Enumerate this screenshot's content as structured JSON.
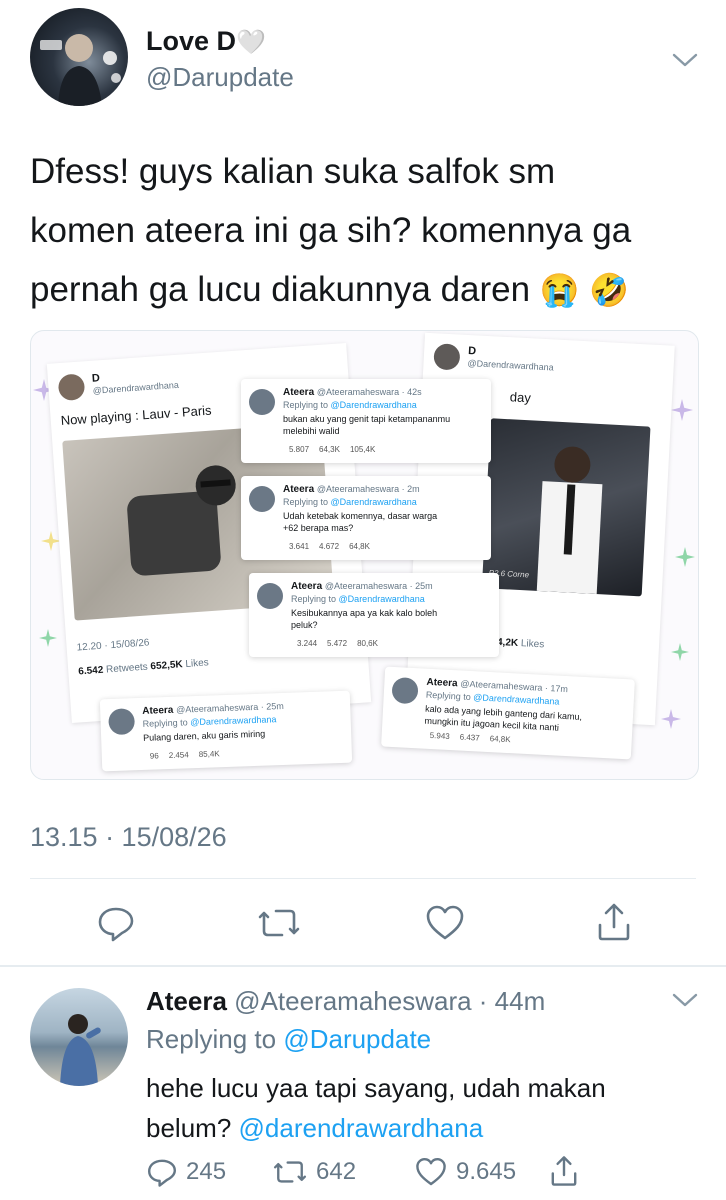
{
  "tweet": {
    "display_name": "Love D",
    "heart_emoji": "🤍",
    "handle": "@Darupdate",
    "text_line1": "Dfess! guys kalian suka salfok sm",
    "text_line2": "komen ateera ini ga sih? komennya ga",
    "text_line3": "pernah ga lucu diakunnya daren",
    "emoji1": "😭",
    "emoji2": "🤣",
    "timestamp": "13.15 · 15/08/26"
  },
  "embedded": {
    "left_post": {
      "name": "D",
      "handle": "@Darendrawardhana",
      "caption": "Now playing : Lauv - Paris",
      "time": "12.20 · 15/08/26",
      "retweets_count": "6.542",
      "retweets_label": "Retweets",
      "likes_count": "652,5K",
      "likes_label": "Likes"
    },
    "right_post": {
      "name": "D",
      "handle": "@Darendrawardhana",
      "caption_fragment": "day",
      "likes_fragment": "4,2K",
      "likes_label": "Likes",
      "photo_text": "P2.6 Corne"
    },
    "reply_cards": [
      {
        "name": "Ateera",
        "handle": "@Ateeramaheswara · 42s",
        "replying": "Replying to",
        "replying_handle": "@Darendrawardhana",
        "text1": "bukan aku yang genit tapi ketampananmu",
        "text2": "melebihi walid",
        "c": "5.807",
        "r": "64,3K",
        "l": "105,4K"
      },
      {
        "name": "Ateera",
        "handle": "@Ateeramaheswara · 2m",
        "replying": "Replying to",
        "replying_handle": "@Darendrawardhana",
        "text1": "Udah ketebak komennya, dasar warga",
        "text2": "+62 berapa mas?",
        "c": "3.641",
        "r": "4.672",
        "l": "64,8K"
      },
      {
        "name": "Ateera",
        "handle": "@Ateeramaheswara · 25m",
        "replying": "Replying to",
        "replying_handle": "@Darendrawardhana",
        "text1": "Kesibukannya apa ya kak kalo boleh",
        "text2": "peluk?",
        "c": "3.244",
        "r": "5.472",
        "l": "80,6K"
      },
      {
        "name": "Ateera",
        "handle": "@Ateeramaheswara · 25m",
        "replying": "Replying to",
        "replying_handle": "@Darendrawardhana",
        "text1": "Pulang daren, aku garis miring",
        "text2": "",
        "c": "96",
        "r": "2.454",
        "l": "85,4K"
      },
      {
        "name": "Ateera",
        "handle": "@Ateeramaheswara · 17m",
        "replying": "Replying to",
        "replying_handle": "@Darendrawardhana",
        "text1": "kalo ada yang lebih ganteng dari kamu,",
        "text2": "mungkin itu jagoan kecil kita nanti",
        "c": "5.943",
        "r": "6.437",
        "l": "64,8K"
      }
    ]
  },
  "reply": {
    "display_name": "Ateera",
    "handle_time": "@Ateeramaheswara · 44m",
    "replying_label": "Replying to",
    "replying_handle": "@Darupdate",
    "text_line1": "hehe lucu yaa tapi sayang, udah makan",
    "text_line2_prefix": "belum?",
    "mention": "@darendrawardhana",
    "comments": "245",
    "retweets": "642",
    "likes": "9.645"
  },
  "icons": {
    "reply": "comment-icon",
    "retweet": "retweet-icon",
    "like": "heart-icon",
    "share": "share-icon",
    "menu": "chevron-down-icon"
  },
  "colors": {
    "text": "#14171a",
    "secondary": "#657786",
    "link": "#1da1f2",
    "divider": "#e6ecf0"
  }
}
